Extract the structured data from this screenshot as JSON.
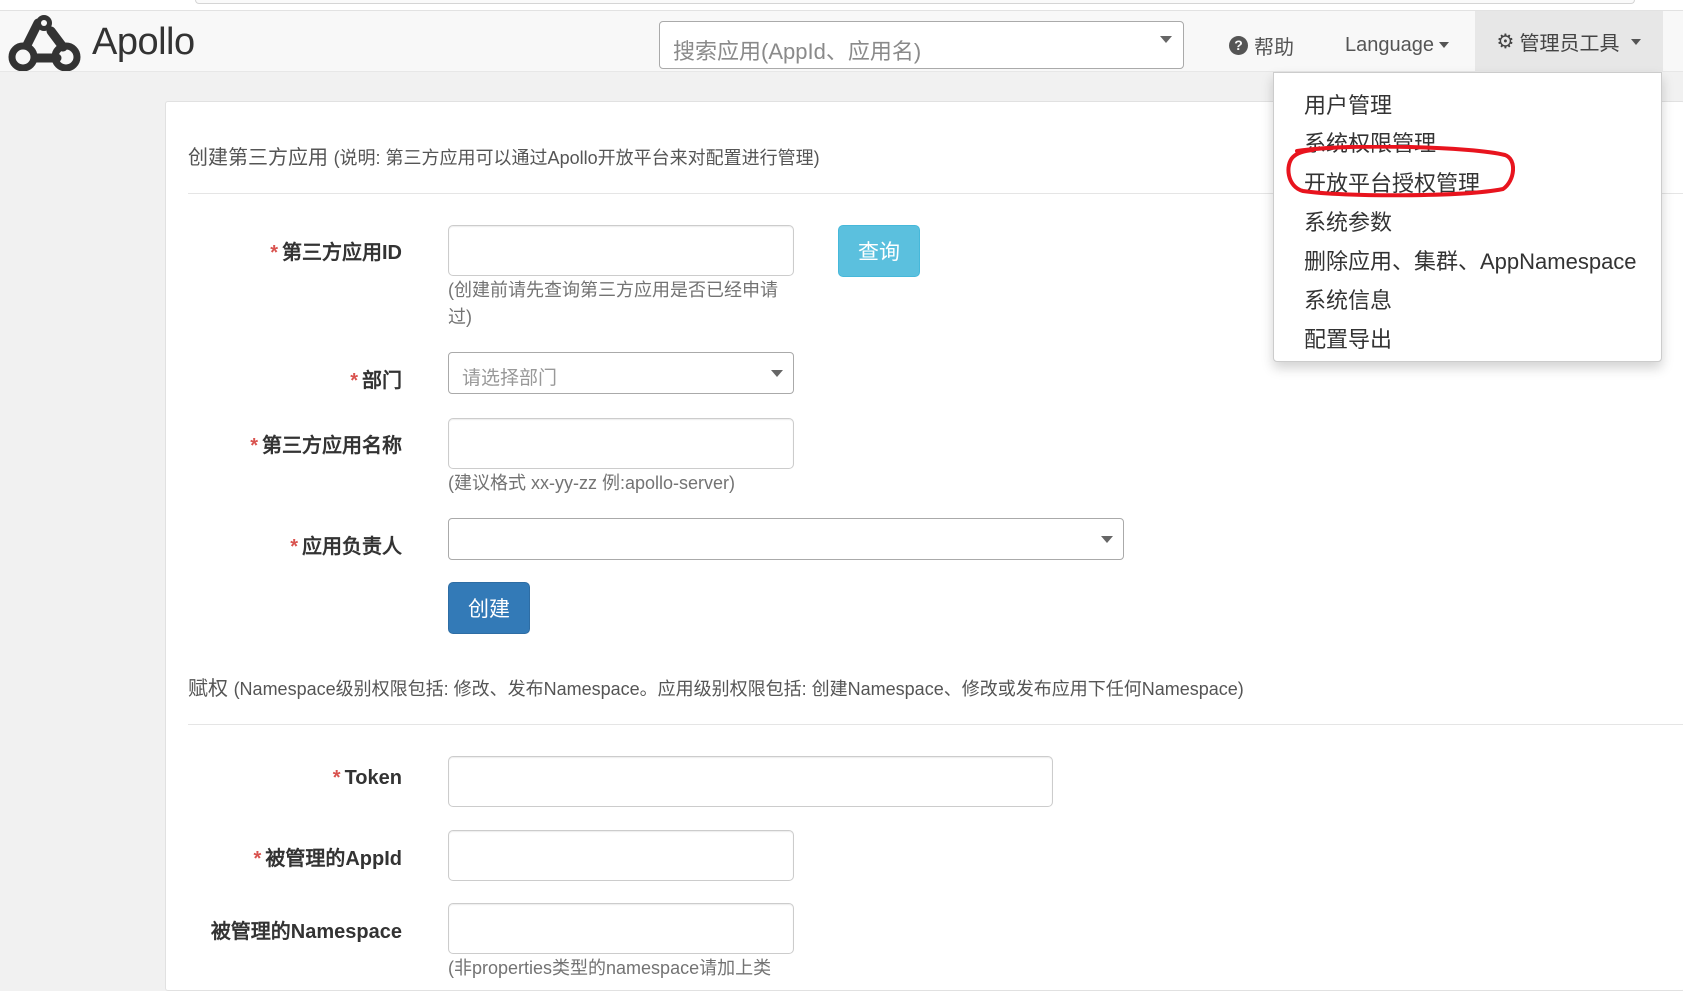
{
  "app": {
    "name": "Apollo"
  },
  "navbar": {
    "search_placeholder": "搜索应用(AppId、应用名)",
    "help_label": "帮助",
    "language_label": "Language",
    "admin_label": "管理员工具"
  },
  "admin_menu": {
    "items": [
      {
        "label": "用户管理"
      },
      {
        "label": "系统权限管理"
      },
      {
        "label": "开放平台授权管理",
        "highlighted": true
      },
      {
        "label": "系统参数"
      },
      {
        "label": "删除应用、集群、AppNamespace"
      },
      {
        "label": "系统信息"
      },
      {
        "label": "配置导出"
      }
    ]
  },
  "create_section": {
    "title": "创建第三方应用",
    "note": "(说明: 第三方应用可以通过Apollo开放平台来对配置进行管理)",
    "fields": {
      "app_id_label": "第三方应用ID",
      "app_id_help": "(创建前请先查询第三方应用是否已经申请过)",
      "query_button": "查询",
      "department_label": "部门",
      "department_placeholder": "请选择部门",
      "app_name_label": "第三方应用名称",
      "app_name_help": "(建议格式 xx-yy-zz 例:apollo-server)",
      "owner_label": "应用负责人"
    },
    "create_button": "创建"
  },
  "grant_section": {
    "title": "赋权",
    "note": "(Namespace级别权限包括: 修改、发布Namespace。应用级别权限包括: 创建Namespace、修改或发布应用下任何Namespace)",
    "fields": {
      "token_label": "Token",
      "managed_appid_label": "被管理的AppId",
      "managed_namespace_label": "被管理的Namespace",
      "namespace_help": "(非properties类型的namespace请加上类"
    }
  },
  "required_mark": "*",
  "colors": {
    "primary": "#337ab7",
    "info": "#5bc0de",
    "required": "#d9534f",
    "annotation": "#e8141e"
  },
  "icons": [
    "apollo-logo-icon",
    "help-icon",
    "gear-icon",
    "chevron-down-icon"
  ]
}
